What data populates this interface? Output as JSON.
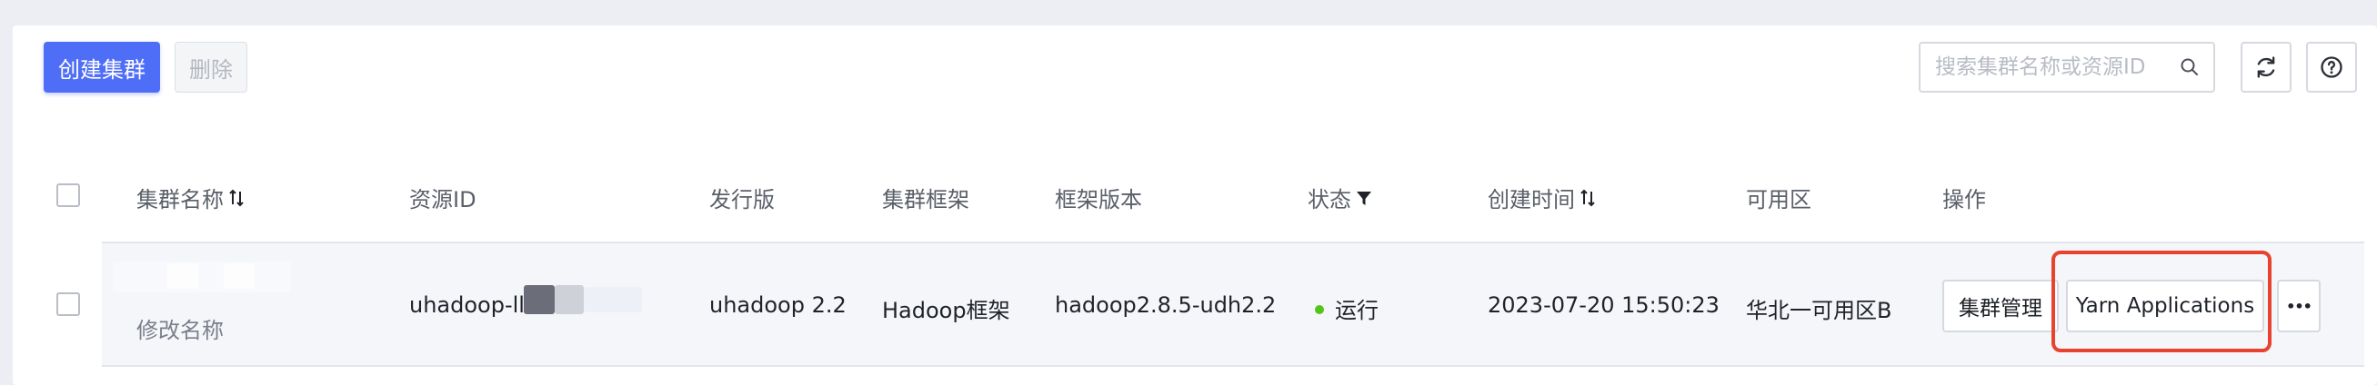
{
  "toolbar": {
    "create_label": "创建集群",
    "delete_label": "删除",
    "search_placeholder": "搜索集群名称或资源ID",
    "refresh_icon": "refresh-icon",
    "help_icon": "help-icon"
  },
  "table": {
    "columns": [
      "集群名称",
      "资源ID",
      "发行版",
      "集群框架",
      "框架版本",
      "状态",
      "创建时间",
      "可用区",
      "操作"
    ],
    "rows": [
      {
        "rename_label": "修改名称",
        "resource_id": "uhadoop-llr",
        "distribution": "uhadoop 2.2",
        "framework": "Hadoop框架",
        "framework_version": "hadoop2.8.5-udh2.2",
        "status": "运行",
        "created_at": "2023-07-20 15:50:23",
        "zone": "华北一可用区B",
        "actions": {
          "manage_label": "集群管理",
          "yarn_label": "Yarn Applications",
          "more_label": "•••"
        }
      }
    ]
  },
  "colors": {
    "primary": "#4f6ef7",
    "status_running": "#52c41a",
    "highlight": "#e8432e"
  }
}
